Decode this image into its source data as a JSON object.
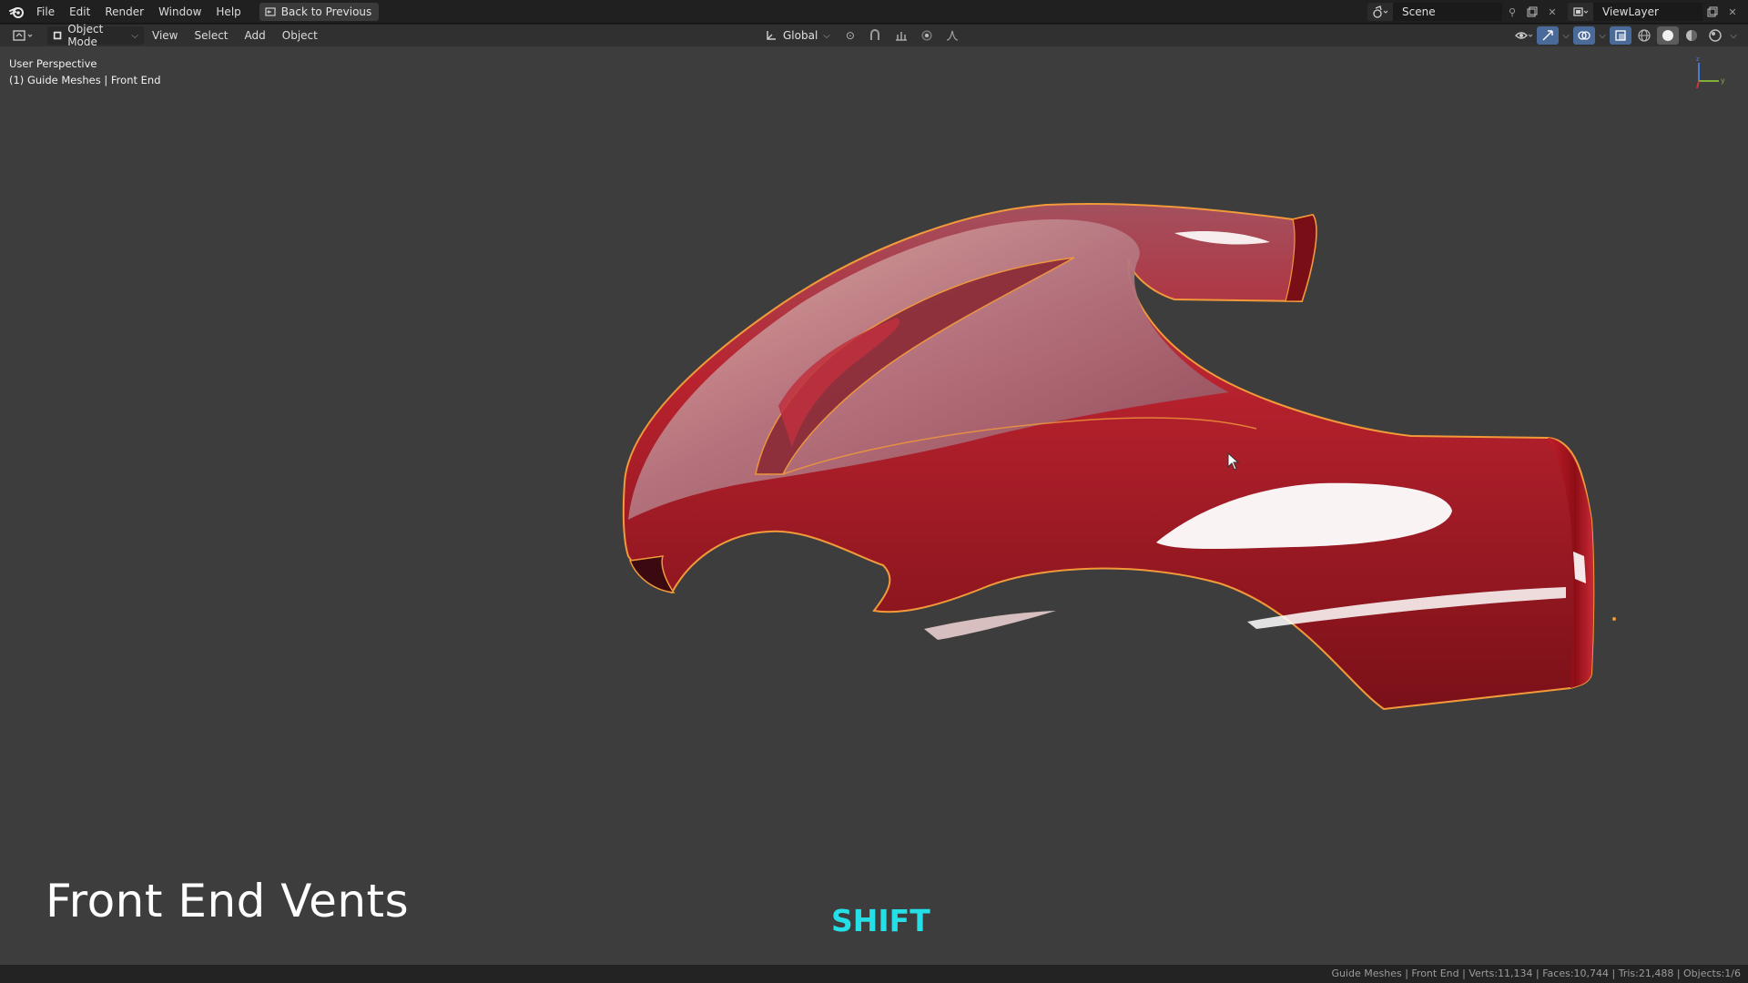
{
  "topbar": {
    "logo_icon": "blender-logo-icon",
    "menus": [
      "File",
      "Edit",
      "Render",
      "Window",
      "Help"
    ],
    "back_button": "Back to Previous",
    "scene_name": "Scene",
    "view_layer": "ViewLayer"
  },
  "viewport_header": {
    "mode": "Object Mode",
    "menus": [
      "View",
      "Select",
      "Add",
      "Object"
    ],
    "orientation": "Global"
  },
  "viewport": {
    "perspective": "User Perspective",
    "active_object": "(1) Guide Meshes | Front End",
    "axis_labels": {
      "y": "y",
      "z": "z"
    }
  },
  "overlay": {
    "title": "Front End Vents",
    "key_hint": "SHIFT",
    "key_hint_color": "#25dfe6"
  },
  "statusbar": {
    "text": "Guide Meshes | Front End | Verts:11,134 | Faces:10,744 | Tris:21,488 | Objects:1/6"
  },
  "colors": {
    "viewport_bg": "#3d3d3d",
    "mesh_red": "#b8222e",
    "selection_outline": "#f29a3a"
  }
}
